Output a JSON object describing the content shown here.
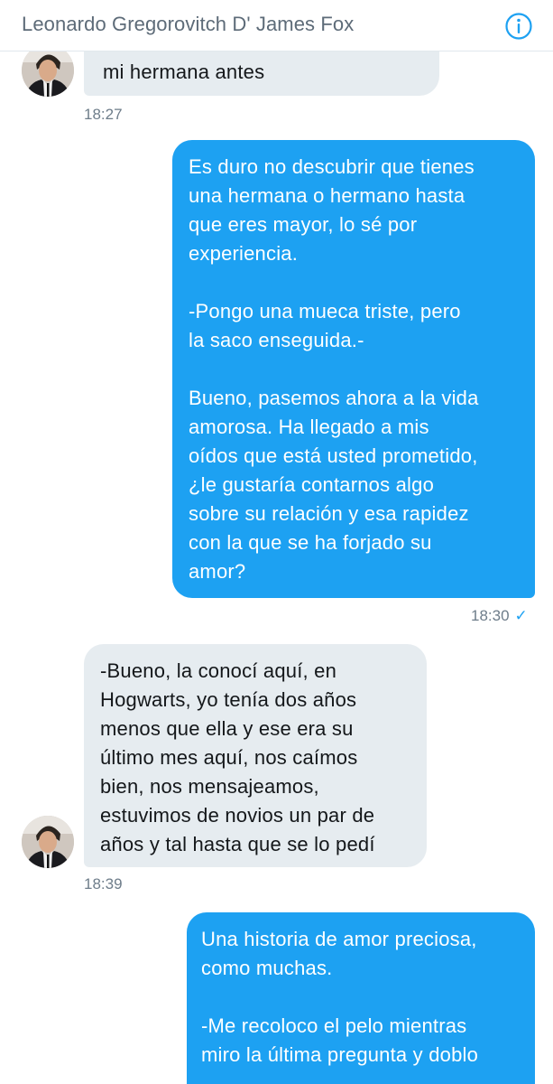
{
  "header": {
    "title": "Leonardo Gregorovitch D' James Fox",
    "info_icon": "info-icon",
    "accent_color": "#1da1f2"
  },
  "messages": [
    {
      "direction": "incoming",
      "paragraphs": [
        "mi hermana antes"
      ],
      "time": "18:27"
    },
    {
      "direction": "outgoing",
      "paragraphs": [
        "Es duro no descubrir que tienes\nuna hermana o hermano hasta\nque eres mayor, lo sé por\nexperiencia.",
        "-Pongo una mueca triste, pero\nla saco enseguida.-",
        "Bueno, pasemos ahora a la vida\namorosa. Ha llegado a mis\noídos que está usted prometido,\n¿le gustaría contarnos algo\nsobre su relación y esa rapidez\ncon la que se ha forjado su\namor?"
      ],
      "time": "18:30",
      "status_icon": "checkmark-icon"
    },
    {
      "direction": "incoming",
      "paragraphs": [
        "-Bueno, la conocí aquí, en\nHogwarts, yo tenía dos años\nmenos que ella y ese era su\núltimo mes aquí, nos caímos\nbien, nos mensajeamos,\nestuvimos de novios un par de\naños y tal hasta que se lo pedí"
      ],
      "time": "18:39"
    },
    {
      "direction": "outgoing",
      "paragraphs": [
        "Una historia de amor preciosa,\ncomo muchas.",
        "-Me recoloco el pelo mientras\nmiro la última pregunta y doblo"
      ]
    }
  ]
}
